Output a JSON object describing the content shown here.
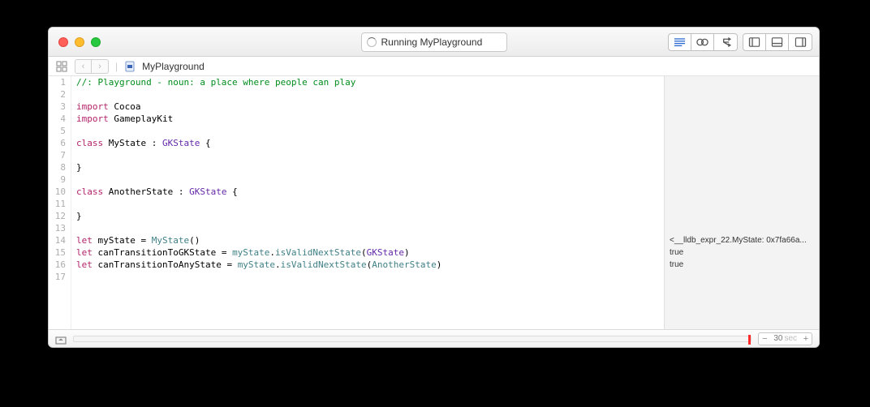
{
  "titlebar": {
    "status_text": "Running MyPlayground"
  },
  "pathbar": {
    "filename": "MyPlayground"
  },
  "code": {
    "lines": [
      {
        "n": 1,
        "tokens": [
          {
            "t": "//: Playground - noun: a place where people can play",
            "c": "tok-comment"
          }
        ]
      },
      {
        "n": 2,
        "tokens": []
      },
      {
        "n": 3,
        "tokens": [
          {
            "t": "import",
            "c": "tok-keyword"
          },
          {
            "t": " Cocoa",
            "c": ""
          }
        ]
      },
      {
        "n": 4,
        "tokens": [
          {
            "t": "import",
            "c": "tok-keyword"
          },
          {
            "t": " GameplayKit",
            "c": ""
          }
        ]
      },
      {
        "n": 5,
        "tokens": []
      },
      {
        "n": 6,
        "tokens": [
          {
            "t": "class",
            "c": "tok-keyword"
          },
          {
            "t": " MyState : ",
            "c": ""
          },
          {
            "t": "GKState",
            "c": "tok-type-system"
          },
          {
            "t": " {",
            "c": ""
          }
        ]
      },
      {
        "n": 7,
        "tokens": []
      },
      {
        "n": 8,
        "tokens": [
          {
            "t": "}",
            "c": ""
          }
        ]
      },
      {
        "n": 9,
        "tokens": []
      },
      {
        "n": 10,
        "tokens": [
          {
            "t": "class",
            "c": "tok-keyword"
          },
          {
            "t": " AnotherState : ",
            "c": ""
          },
          {
            "t": "GKState",
            "c": "tok-type-system"
          },
          {
            "t": " {",
            "c": ""
          }
        ]
      },
      {
        "n": 11,
        "tokens": []
      },
      {
        "n": 12,
        "tokens": [
          {
            "t": "}",
            "c": ""
          }
        ]
      },
      {
        "n": 13,
        "tokens": []
      },
      {
        "n": 14,
        "tokens": [
          {
            "t": "let",
            "c": "tok-keyword"
          },
          {
            "t": " myState = ",
            "c": ""
          },
          {
            "t": "MyState",
            "c": "tok-type-user"
          },
          {
            "t": "()",
            "c": ""
          }
        ]
      },
      {
        "n": 15,
        "tokens": [
          {
            "t": "let",
            "c": "tok-keyword"
          },
          {
            "t": " canTransitionToGKState = ",
            "c": ""
          },
          {
            "t": "myState",
            "c": "tok-member"
          },
          {
            "t": ".",
            "c": ""
          },
          {
            "t": "isValidNextState",
            "c": "tok-member"
          },
          {
            "t": "(",
            "c": ""
          },
          {
            "t": "GKState",
            "c": "tok-type-system"
          },
          {
            "t": ")",
            "c": ""
          }
        ]
      },
      {
        "n": 16,
        "tokens": [
          {
            "t": "let",
            "c": "tok-keyword"
          },
          {
            "t": " canTransitionToAnyState = ",
            "c": ""
          },
          {
            "t": "myState",
            "c": "tok-member"
          },
          {
            "t": ".",
            "c": ""
          },
          {
            "t": "isValidNextState",
            "c": "tok-member"
          },
          {
            "t": "(",
            "c": ""
          },
          {
            "t": "AnotherState",
            "c": "tok-type-user"
          },
          {
            "t": ")",
            "c": ""
          }
        ]
      },
      {
        "n": 17,
        "tokens": []
      }
    ]
  },
  "results": {
    "lines": [
      {
        "n": 14,
        "text": "<__lldb_expr_22.MyState: 0x7fa66a..."
      },
      {
        "n": 15,
        "text": "true"
      },
      {
        "n": 16,
        "text": "true"
      }
    ]
  },
  "bottombar": {
    "time_value": "30",
    "time_unit": "sec",
    "minus": "−",
    "plus": "+"
  }
}
